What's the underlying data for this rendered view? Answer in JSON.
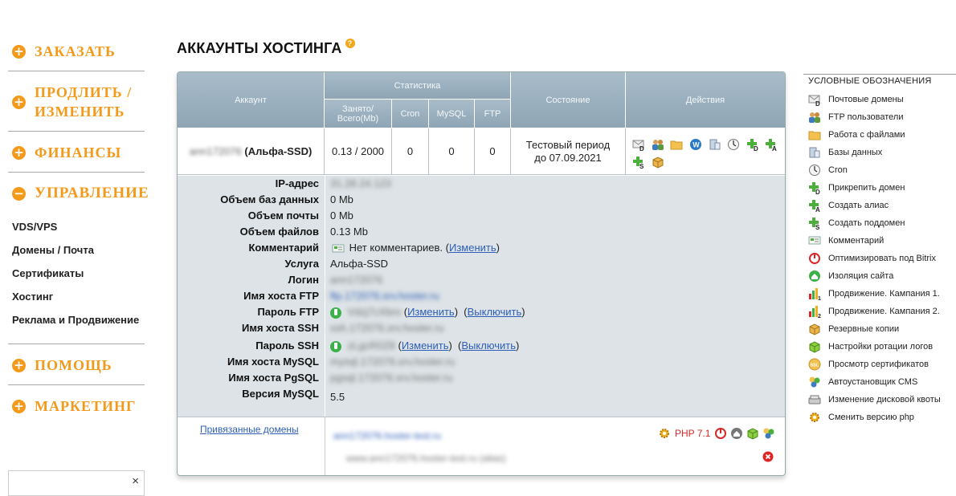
{
  "sidebar": {
    "order": "ЗАКАЗАТЬ",
    "extend": "ПРОДЛИТЬ / ИЗМЕНИТЬ",
    "finance": "ФИНАНСЫ",
    "manage": "УПРАВЛЕНИЕ",
    "manage_items": [
      "VDS/VPS",
      "Домены / Почта",
      "Сертификаты",
      "Хостинг",
      "Реклама и Продвижение"
    ],
    "help": "ПОМОЩЬ",
    "marketing": "МАРКЕТИНГ",
    "close_glyph": "×"
  },
  "page": {
    "title": "АККАУНТЫ ХОСТИНГА",
    "help_glyph": "?"
  },
  "table": {
    "headers": {
      "account": "Аккаунт",
      "stats": "Статистика",
      "used": "Занято/ Всего(Mb)",
      "cron": "Cron",
      "mysql": "MySQL",
      "ftp": "FTP",
      "state": "Состояние",
      "actions": "Действия"
    },
    "row": {
      "account_login": "ann172076",
      "account_plan": "(Альфа-SSD)",
      "used": "0.13 / 2000",
      "cron": "0",
      "mysql": "0",
      "ftp": "0",
      "state_line1": "Тестовый период",
      "state_line2": "до 07.09.2021"
    }
  },
  "details": {
    "ip_label": "IP-адрес",
    "ip_value": "31.28.24.123",
    "db_label": "Объем баз данных",
    "db_value": "0 Mb",
    "mail_label": "Объем почты",
    "mail_value": "0 Mb",
    "files_label": "Объем файлов",
    "files_value": "0.13 Mb",
    "comment_label": "Комментарий",
    "comment_value": "Нет комментариев.",
    "comment_change": "Изменить",
    "service_label": "Услуга",
    "service_value": "Альфа-SSD",
    "login_label": "Логин",
    "login_value": "ann172076",
    "ftp_host_label": "Имя хоста FTP",
    "ftp_host_value": "ftp.172076.srv.hoster.ru",
    "ftp_pass_label": "Пароль FTP",
    "ftp_pass_value": "Vdzj7cXbro",
    "ftp_change": "Изменить",
    "ftp_disable": "Выключить",
    "ssh_host_label": "Имя хоста SSH",
    "ssh_host_value": "ssh.172076.srv.hoster.ru",
    "ssh_pass_label": "Пароль SSH",
    "ssh_pass_value": "zLgcR0Z8",
    "ssh_change": "Изменить",
    "ssh_disable": "Выключить",
    "mysql_host_label": "Имя хоста MySQL",
    "mysql_host_value": "mysql.172076.srv.hoster.ru",
    "pgsql_host_label": "Имя хоста PgSQL",
    "pgsql_host_value": "pgsql.172076.srv.hoster.ru",
    "mysql_ver_label": "Версия MySQL",
    "mysql_ver_value": "5.5"
  },
  "domains": {
    "link": "Привязанные домены",
    "main_domain": "ann172076.hoster-test.ru",
    "alias": "www.ann172076.hoster-test.ru (alias)",
    "php": "PHP 7.1"
  },
  "legend": {
    "title": "УСЛОВНЫЕ ОБОЗНАЧЕНИЯ",
    "items": [
      "Почтовые домены",
      "FTP пользователи",
      "Работа с файлами",
      "Базы данных",
      "Cron",
      "Прикрепить домен",
      "Создать алиас",
      "Создать поддомен",
      "Комментарий",
      "Оптимизировать под Bitrix",
      "Изоляция сайта",
      "Продвижение. Кампания 1.",
      "Продвижение. Кампания 2.",
      "Резервные копии",
      "Настройки ротации логов",
      "Просмотр сертификатов",
      "Автоустановщик CMS",
      "Изменение дисковой квоты",
      "Сменить версию php"
    ]
  },
  "colors": {
    "accent": "#f39a1b",
    "header_bg": "#9db2c1",
    "details_bg": "#dde3e6",
    "link": "#2d5fb8",
    "php": "#d62828"
  }
}
